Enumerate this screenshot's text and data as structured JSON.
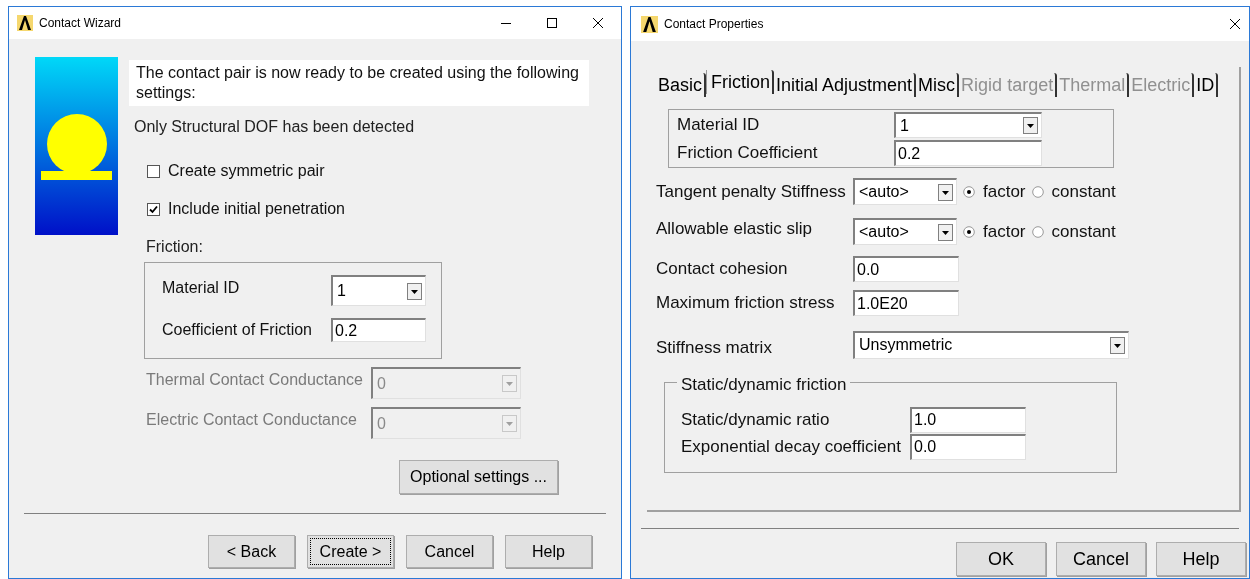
{
  "wizard": {
    "title": "Contact Wizard",
    "message": "The contact pair is now ready to be created using the following settings:",
    "dof_note": "Only Structural DOF has been detected",
    "options": [
      {
        "label": "Create symmetric pair",
        "checked": false
      },
      {
        "label": "Include initial penetration",
        "checked": true
      }
    ],
    "friction_label": "Friction:",
    "friction_fields": [
      {
        "kind": "dropdown",
        "label": "Material ID",
        "value": "1"
      },
      {
        "kind": "text",
        "label": "Coefficient of Friction",
        "value": "0.2"
      }
    ],
    "conductance": [
      {
        "label": "Thermal Contact Conductance",
        "value": "0",
        "disabled": true
      },
      {
        "label": "Electric Contact Conductance",
        "value": "0",
        "disabled": true
      }
    ],
    "optional_button": "Optional settings ...",
    "buttons": [
      {
        "label": "< Back",
        "focused": false
      },
      {
        "label": "Create >",
        "focused": true
      },
      {
        "label": "Cancel",
        "focused": false
      },
      {
        "label": "Help",
        "focused": false
      }
    ]
  },
  "properties": {
    "title": "Contact Properties",
    "tabs": [
      {
        "label": "Basic",
        "selected": false,
        "disabled": false
      },
      {
        "label": "Friction",
        "selected": true,
        "disabled": false
      },
      {
        "label": "Initial Adjustment",
        "selected": false,
        "disabled": false
      },
      {
        "label": "Misc",
        "selected": false,
        "disabled": false
      },
      {
        "label": "Rigid target",
        "selected": false,
        "disabled": true
      },
      {
        "label": "Thermal",
        "selected": false,
        "disabled": true
      },
      {
        "label": "Electric",
        "selected": false,
        "disabled": true
      },
      {
        "label": "ID",
        "selected": false,
        "disabled": false
      }
    ],
    "material_fields": [
      {
        "kind": "dropdown",
        "label": "Material ID",
        "value": "1"
      },
      {
        "kind": "text",
        "label": "Friction Coefficient",
        "value": "0.2"
      }
    ],
    "stiffness_rows": [
      {
        "label": "Tangent penalty Stiffness",
        "value": "<auto>",
        "options": [
          {
            "label": "factor",
            "selected": true
          },
          {
            "label": "constant",
            "selected": false
          }
        ]
      },
      {
        "label": "Allowable elastic slip",
        "value": "<auto>",
        "options": [
          {
            "label": "factor",
            "selected": true
          },
          {
            "label": "constant",
            "selected": false
          }
        ]
      }
    ],
    "fields": [
      {
        "label": "Contact cohesion",
        "value": "0.0"
      },
      {
        "label": "Maximum friction stress",
        "value": "1.0E20"
      }
    ],
    "stiffness_matrix": {
      "label": "Stiffness matrix",
      "value": "Unsymmetric"
    },
    "static_dynamic": {
      "title": "Static/dynamic friction",
      "fields": [
        {
          "label": "Static/dynamic ratio",
          "value": "1.0"
        },
        {
          "label": "Exponential decay coefficient",
          "value": "0.0"
        }
      ]
    },
    "buttons": [
      "OK",
      "Cancel",
      "Help"
    ]
  }
}
